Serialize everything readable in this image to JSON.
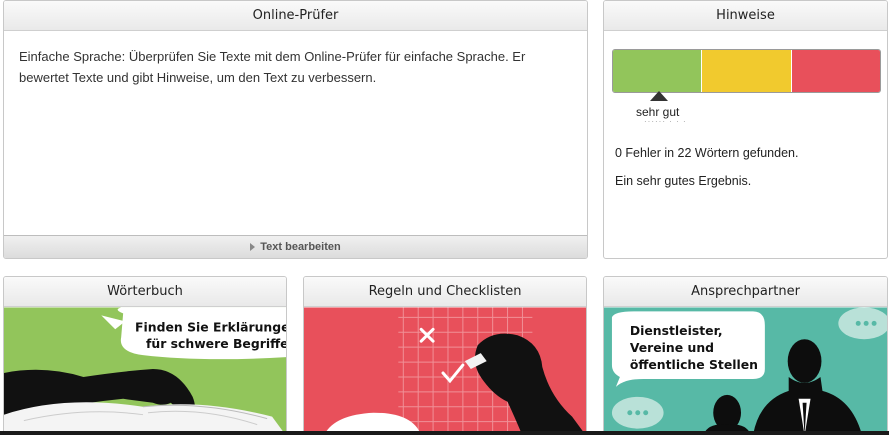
{
  "online_pruefer": {
    "title": "Online-Prüfer",
    "description": "Einfache Sprache: Überprüfen Sie Texte mit dem Online-Prüfer für einfache Sprache. Er bewertet Texte und gibt Hinweise, um den Text zu verbessern.",
    "edit_label": "Text bearbeiten"
  },
  "hinweise": {
    "title": "Hinweise",
    "scale_colors": [
      "#92c55b",
      "#f1ca2e",
      "#e8505b"
    ],
    "rating": "sehr gut",
    "rating_level": "good",
    "errors_line": "0 Fehler in 22 Wörtern gefunden.",
    "result_line": "Ein sehr gutes Ergebnis."
  },
  "cards": {
    "woerterbuch": {
      "title": "Wörterbuch",
      "bubble_line1": "Finden Sie Erklärungen",
      "bubble_line2": "für schwere Begriffe",
      "bg_color": "#92c55b"
    },
    "regeln": {
      "title": "Regeln und Checklisten",
      "bg_color": "#e8505b"
    },
    "ansprechpartner": {
      "title": "Ansprechpartner",
      "bubble_line1": "Dienstleister,",
      "bubble_line2": "Vereine und",
      "bubble_line3": "öffentliche Stellen",
      "bg_color": "#57b9a6"
    }
  }
}
